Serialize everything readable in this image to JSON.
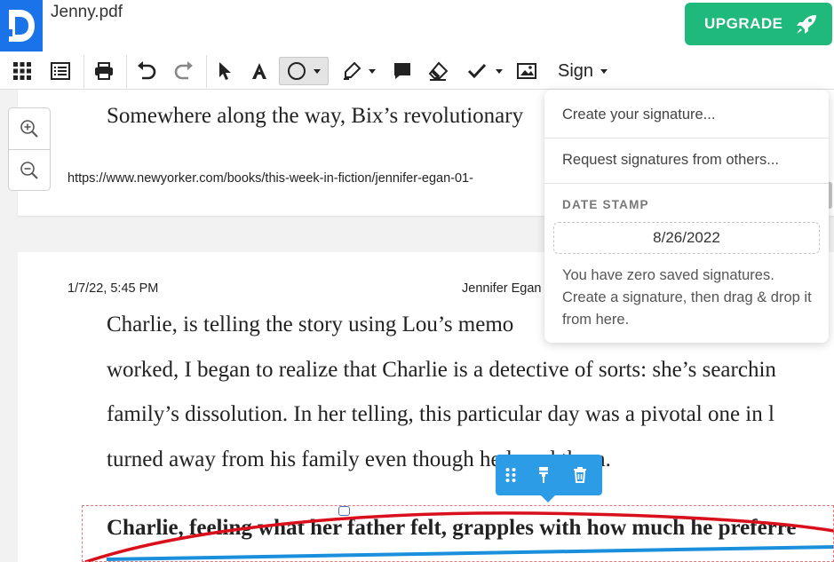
{
  "app": {
    "filename": "Jenny.pdf",
    "upgrade_label": "UPGRADE"
  },
  "toolbar": {
    "sign_label": "Sign"
  },
  "document": {
    "page1": {
      "line1": "Somewhere along the way, Bix’s revolutionary",
      "url": "https://www.newyorker.com/books/this-week-in-fiction/jennifer-egan-01-"
    },
    "page2": {
      "date": "1/7/22, 5:45 PM",
      "author": "Jennifer Egan",
      "line1": "Charlie, is telling the story using Lou’s memo",
      "line2": "worked, I began to realize that Charlie is a detective of sorts: she’s searchin",
      "line3": "family’s dissolution. In her telling, this particular day was a pivotal one in l",
      "line4": "turned away from his family even though he loved them.",
      "bold_line": "Charlie, feeling what her father felt, grapples with how much he preferre"
    }
  },
  "sign_menu": {
    "create": "Create your signature...",
    "request": "Request signatures from others...",
    "date_stamp_heading": "DATE STAMP",
    "date_value": "8/26/2022",
    "note": "You have zero saved signatures. Create a signature, then drag & drop it from here."
  },
  "colors": {
    "brand_blue": "#1a73e8",
    "upgrade_green": "#20b97c",
    "context_blue": "#2d9ce6",
    "ellipse_red": "#d9101c"
  }
}
